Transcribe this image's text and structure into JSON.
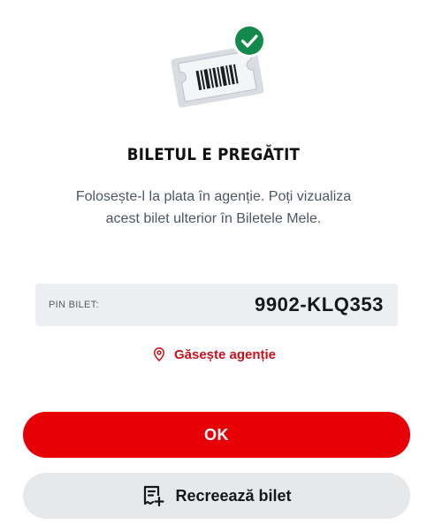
{
  "illustration": {
    "ticket_icon": "ticket-barcode-icon",
    "badge_icon": "check-badge-icon",
    "badge_color": "#138a4b"
  },
  "title": "BILETUL E PREGĂTIT",
  "subtitle": {
    "line1": "Folosește-l la plata în agenție. Poți vizualiza",
    "line2": "acest bilet ulterior în Biletele Mele."
  },
  "pin": {
    "label": "PIN BILET:",
    "value": "9902-KLQ353"
  },
  "find_agency": {
    "label": "Găsește agenție",
    "icon": "location-pin-icon",
    "color": "#c8111a"
  },
  "ok_button": {
    "label": "OK",
    "color": "#e60006"
  },
  "recreate_button": {
    "label": "Recreează bilet",
    "icon": "receipt-add-icon"
  }
}
